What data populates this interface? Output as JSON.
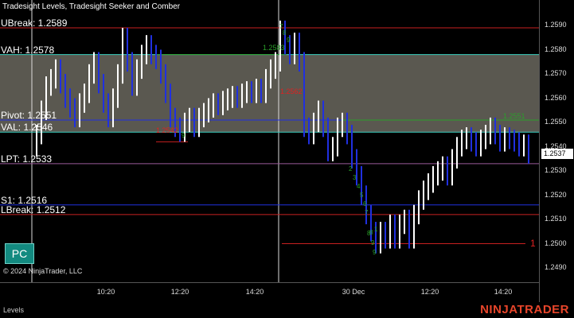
{
  "indicator_title": "Tradesight Levels, Tradesight Seeker and Comber",
  "levels": [
    {
      "label": "UBreak: 1.2589",
      "price": 1.2589,
      "color": "#c82020"
    },
    {
      "label": "VAH: 1.2578",
      "price": 1.2578,
      "color": "#3ad0c0"
    },
    {
      "label": "Pivot: 1.2551",
      "price": 1.2551,
      "color": "#2030e0"
    },
    {
      "label": "VAL: 1.2546",
      "price": 1.2546,
      "color": "#3ad0c0"
    },
    {
      "label": "LPT: 1.2533",
      "price": 1.2533,
      "color": "#9a5a9a"
    },
    {
      "label": "S1: 1.2516",
      "price": 1.2516,
      "color": "#2030e0"
    },
    {
      "label": "LBreak: 1.2512",
      "price": 1.2512,
      "color": "#c82020"
    }
  ],
  "price_axis": {
    "ticks": [
      "1.2590",
      "1.2580",
      "1.2570",
      "1.2560",
      "1.2550",
      "1.2540",
      "1.2530",
      "1.2520",
      "1.2510",
      "1.2500",
      "1.2490"
    ],
    "current_price": "1.2537"
  },
  "time_axis": {
    "labels": [
      "10:20",
      "12:20",
      "14:20",
      "30 Dec",
      "12:20",
      "14:20"
    ]
  },
  "annotations": {
    "seeker_labels": [
      {
        "text": "1.2583",
        "color": "#2aa02a"
      },
      {
        "text": "1.2542",
        "color": "#e02020"
      },
      {
        "text": "1.2562",
        "color": "#e02020"
      },
      {
        "text": "1.2551",
        "color": "#2aa02a"
      }
    ],
    "counts": [
      "7",
      "8",
      "9",
      "9",
      "7",
      "8",
      "9",
      "2",
      "3",
      "4",
      "5",
      "6",
      "8",
      "9",
      "1"
    ],
    "target_marker": "1"
  },
  "button_pc": "PC",
  "copyright": "© 2024 NinjaTrader, LLC",
  "tab_label": "Levels",
  "brand": "NINJATRADER",
  "colors": {
    "background": "#000000",
    "value_area_fill": "#5a5850",
    "up_bar": "#ffffff",
    "down_bar": "#2030e0",
    "brand": "#e8452a",
    "pc_button": "#138a80"
  }
}
